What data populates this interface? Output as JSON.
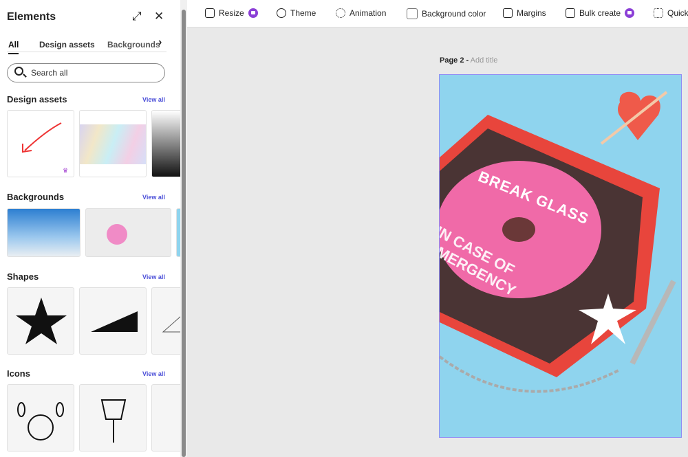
{
  "panel": {
    "title": "Elements",
    "tabs": [
      "All",
      "Design assets",
      "Backgrounds"
    ],
    "search_placeholder": "Search all",
    "sections": [
      {
        "title": "Design assets",
        "view_all": "View all"
      },
      {
        "title": "Backgrounds",
        "view_all": "View all"
      },
      {
        "title": "Shapes",
        "view_all": "View all"
      },
      {
        "title": "Icons",
        "view_all": "View all"
      }
    ]
  },
  "toolbar": {
    "items": [
      "Resize",
      "Theme",
      "Animation",
      "Background color",
      "Margins",
      "Bulk create",
      "Quick"
    ]
  },
  "page": {
    "label": "Page 2 -",
    "title_placeholder": "Add title",
    "text_top": "BREAK GLASS",
    "text_bottom": "IN CASE OF EMERGENCY"
  },
  "colors": {
    "accent": "#4b4fd8",
    "premium": "#8b3fd6",
    "page_bg": "#8fd4ee",
    "box": "#e8453c"
  }
}
